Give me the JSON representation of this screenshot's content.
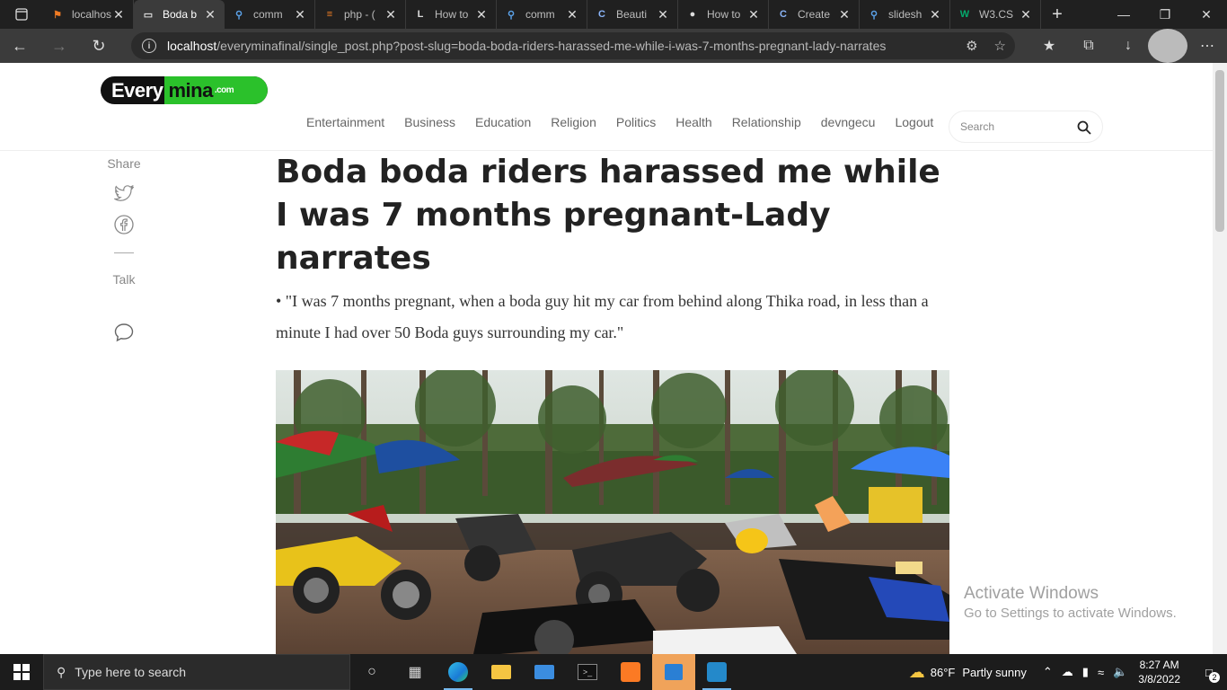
{
  "browser": {
    "tabs": [
      {
        "title": "localhost",
        "favicon": "xampp-icon",
        "active": false
      },
      {
        "title": "Boda b",
        "favicon": "page-icon",
        "active": true
      },
      {
        "title": "comm",
        "favicon": "search-icon",
        "active": false
      },
      {
        "title": "php - (",
        "favicon": "stack-icon",
        "active": false
      },
      {
        "title": "How to",
        "favicon": "L-icon",
        "active": false
      },
      {
        "title": "comm",
        "favicon": "search-icon",
        "active": false
      },
      {
        "title": "Beauti",
        "favicon": "c-icon",
        "active": false
      },
      {
        "title": "How to",
        "favicon": "github-icon",
        "active": false
      },
      {
        "title": "Create",
        "favicon": "c-icon",
        "active": false
      },
      {
        "title": "slidesh",
        "favicon": "search-icon",
        "active": false
      },
      {
        "title": "W3.CS",
        "favicon": "w3-icon",
        "active": false
      }
    ],
    "url_host": "localhost",
    "url_path": "/everyminafinal/single_post.php?post-slug=boda-boda-riders-harassed-me-while-i-was-7-months-pregnant-lady-narrates"
  },
  "site": {
    "logo_left": "Every",
    "logo_right": "mina",
    "logo_domain": ".com",
    "nav": [
      "Entertainment",
      "Business",
      "Education",
      "Religion",
      "Politics",
      "Health",
      "Relationship",
      "devngecu",
      "Logout"
    ],
    "search_placeholder": "Search",
    "share_label": "Share",
    "talk_label": "Talk"
  },
  "article": {
    "title": "Boda boda riders harassed me while I was 7 months pregnant-Lady narrates",
    "lede": "• \"I was 7 months pregnant, when a boda guy hit my car from behind along Thika road, in less than a minute I had over 50 Boda guys surrounding my car.\""
  },
  "watermark": {
    "title": "Activate Windows",
    "subtitle": "Go to Settings to activate Windows."
  },
  "taskbar": {
    "search_placeholder": "Type here to search",
    "weather_temp": "86°F",
    "weather_text": "Partly sunny",
    "time": "8:27 AM",
    "date": "3/8/2022",
    "notification_count": "2"
  },
  "colors": {
    "accent_green": "#2bc12b",
    "title_text": "#222222"
  }
}
